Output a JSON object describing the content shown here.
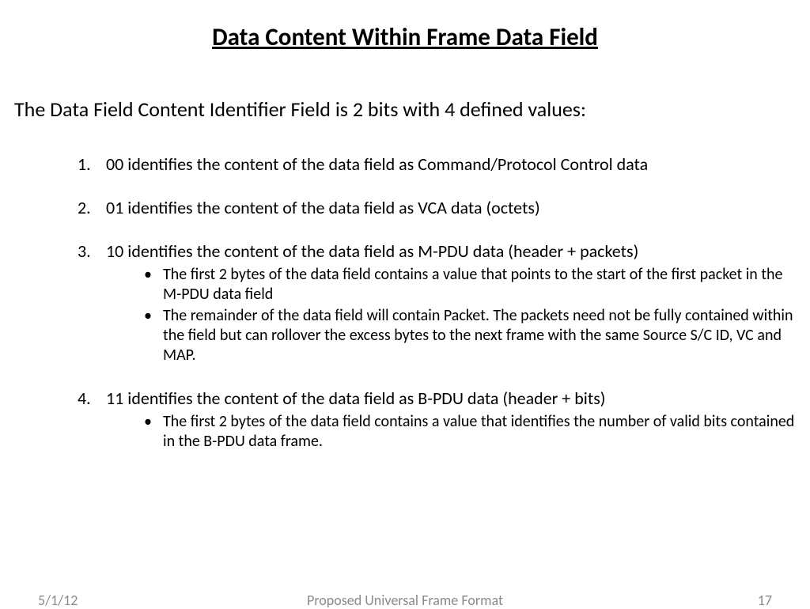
{
  "title": "Data Content Within Frame Data Field",
  "intro": "The Data Field Content Identifier Field is 2 bits with 4 defined values:",
  "items": [
    {
      "text": "00 identifies the content of the data field as Command/Protocol Control data",
      "sub": []
    },
    {
      "text": "01 identifies the content of the data field as VCA data (octets)",
      "sub": []
    },
    {
      "text": "10 identifies the content of the data field as M-PDU data (header + packets)",
      "sub": [
        "The first 2 bytes of the data field contains a value that points to the start of the first packet in the M-PDU data field",
        "The remainder of the data field will contain Packet.  The packets need not be fully contained within the field but can rollover the excess bytes to the next frame with the same Source S/C ID, VC and MAP."
      ]
    },
    {
      "text": "11 identifies the content of the data field as B-PDU data (header + bits)",
      "sub": [
        "The first 2 bytes of the data field contains a value that identifies the number of valid bits contained in the B-PDU data frame."
      ]
    }
  ],
  "footer": {
    "date": "5/1/12",
    "center": "Proposed Universal Frame Format",
    "page": "17"
  }
}
